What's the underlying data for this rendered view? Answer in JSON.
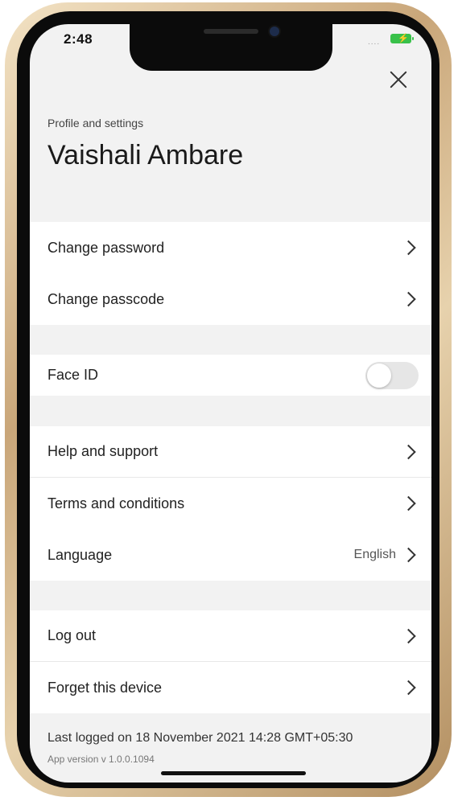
{
  "status_bar": {
    "time": "2:48",
    "signal": "....",
    "battery_color": "#39c14a"
  },
  "header": {
    "close_icon": "close-icon",
    "caption": "Profile and settings",
    "user_name": "Vaishali Ambare"
  },
  "security": {
    "change_password": "Change password",
    "change_passcode": "Change passcode"
  },
  "biometrics": {
    "face_id_label": "Face ID",
    "face_id_enabled": false
  },
  "support": {
    "help": "Help and support",
    "terms": "Terms and conditions",
    "language_label": "Language",
    "language_value": "English"
  },
  "account": {
    "log_out": "Log out",
    "forget_device": "Forget this device"
  },
  "footer": {
    "last_logged": "Last logged on 18 November 2021 14:28 GMT+05:30",
    "app_version": "App version v 1.0.0.1094"
  }
}
